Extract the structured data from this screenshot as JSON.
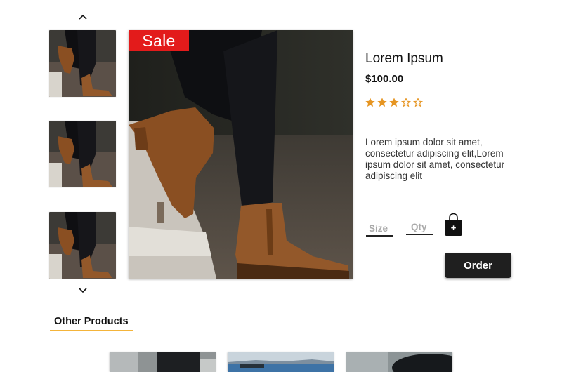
{
  "thumbnails": [
    {
      "alt": "Product thumbnail 1"
    },
    {
      "alt": "Product thumbnail 2"
    },
    {
      "alt": "Product thumbnail 3"
    }
  ],
  "icons": {
    "scroll_up": "chevron-up-icon",
    "scroll_down": "chevron-down-icon",
    "bag": "shopping-bag-plus-icon",
    "star_filled": "star-filled-icon",
    "star_empty": "star-outline-icon"
  },
  "product": {
    "badge": "Sale",
    "title": "Lorem Ipsum",
    "price": "$100.00",
    "rating": 3,
    "rating_max": 5,
    "description": "Lorem ipsum dolor sit amet, consectetur adipiscing elit,Lorem ipsum dolor sit amet, consectetur adipiscing elit",
    "size_label": "Size",
    "qty_label": "Qty",
    "bag_symbol": "+",
    "order_label": "Order"
  },
  "other_products": {
    "title": "Other Products",
    "items": [
      {
        "name": "other-product-1"
      },
      {
        "name": "other-product-2"
      },
      {
        "name": "other-product-3"
      }
    ]
  },
  "colors": {
    "sale_badge": "#e31b1b",
    "star": "#e69522",
    "button_bg": "#1f1f1f",
    "underline_accent": "#f4b43a"
  }
}
